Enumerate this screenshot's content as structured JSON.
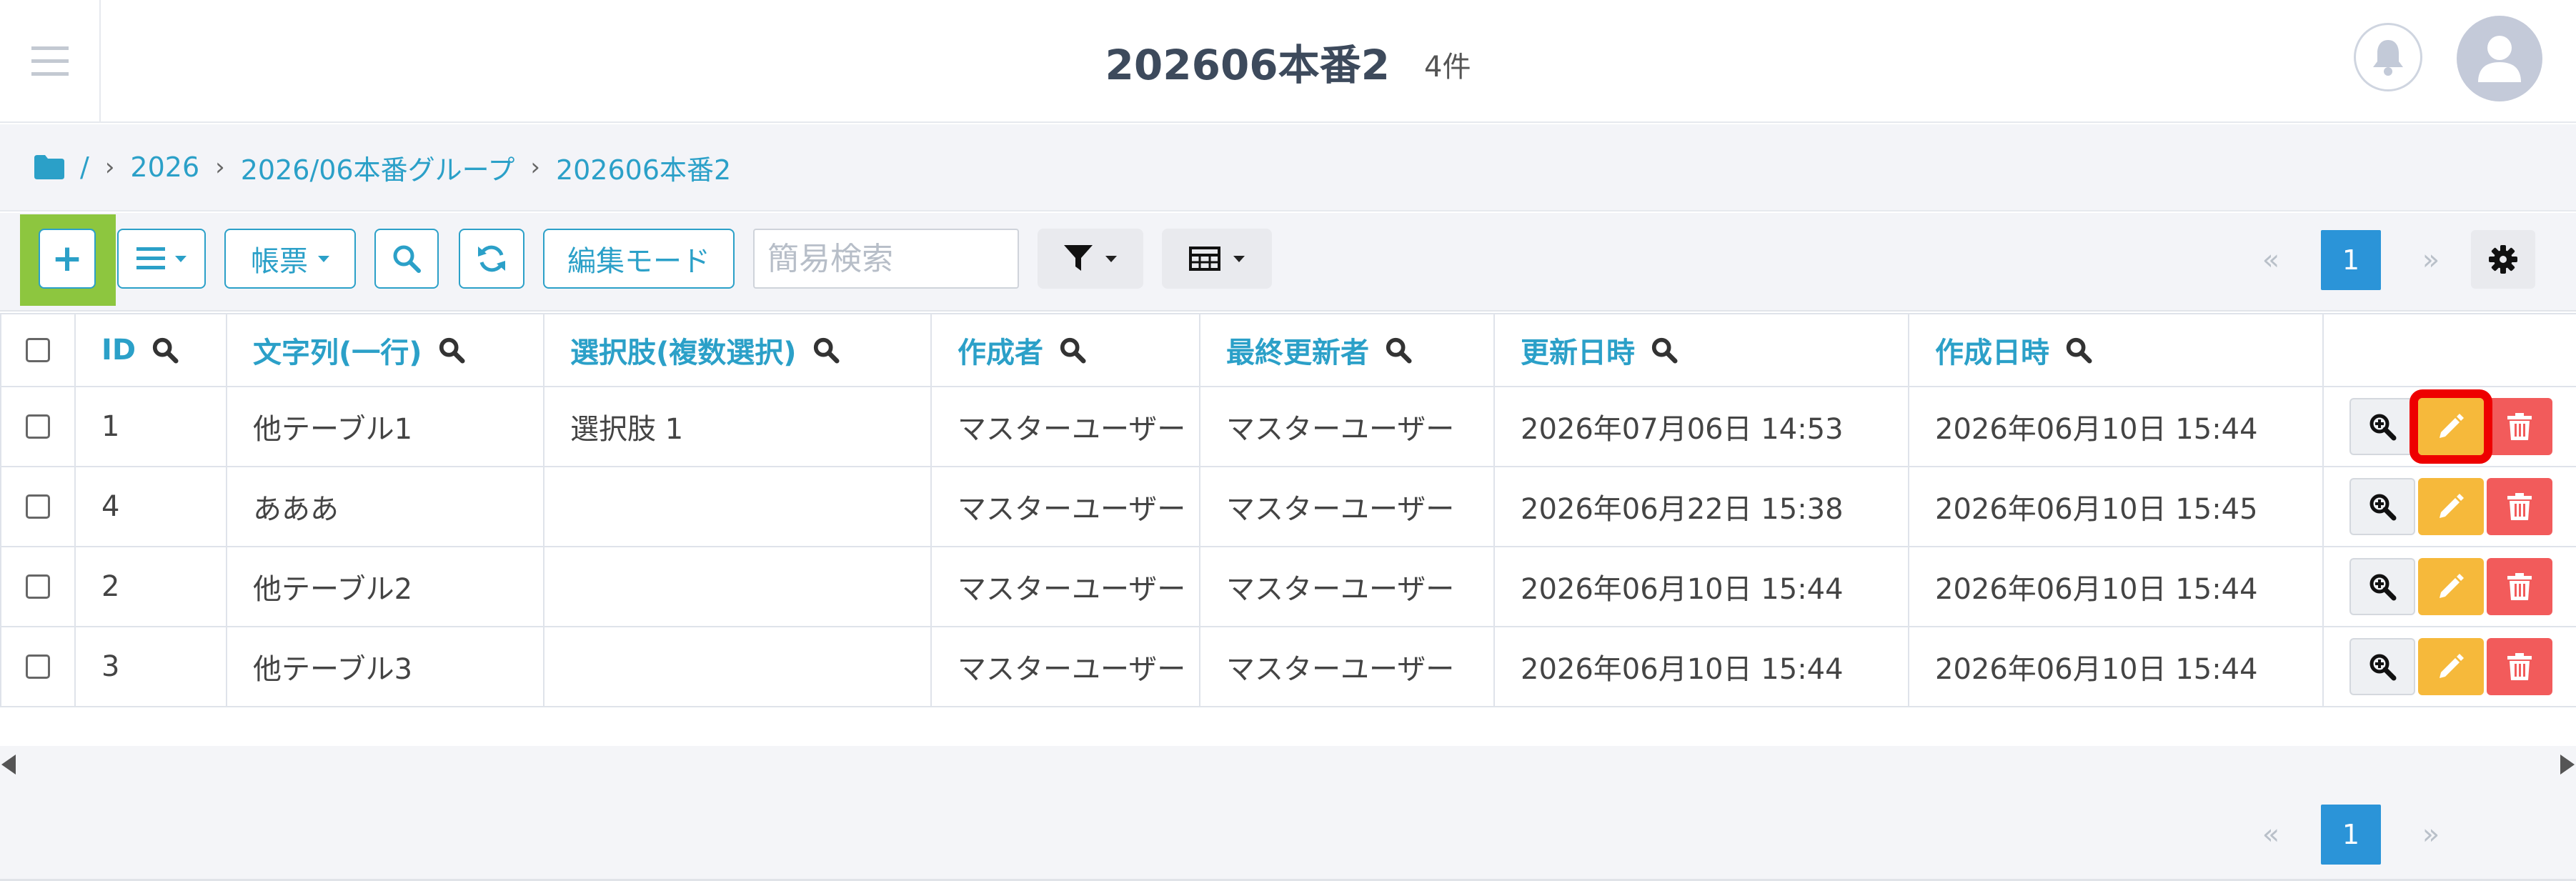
{
  "header": {
    "title": "202606本番2",
    "count": "4件"
  },
  "breadcrumb": {
    "root": "/",
    "items": [
      "2026",
      "2026/06本番グループ",
      "202606本番2"
    ]
  },
  "toolbar": {
    "add_label": "+",
    "report_label": "帳票",
    "edit_mode_label": "編集モード",
    "search_placeholder": "簡易検索",
    "pager": {
      "prev": "«",
      "current": "1",
      "next": "»"
    }
  },
  "table": {
    "columns": [
      "ID",
      "文字列(一行)",
      "選択肢(複数選択)",
      "作成者",
      "最終更新者",
      "更新日時",
      "作成日時"
    ],
    "rows": [
      {
        "id": "1",
        "text": "他テーブル1",
        "choice": "選択肢 1",
        "creator": "マスターユーザー",
        "updater": "マスターユーザー",
        "updated": "2026年07月06日 14:53",
        "created": "2026年06月10日 15:44"
      },
      {
        "id": "4",
        "text": "あああ",
        "choice": "",
        "creator": "マスターユーザー",
        "updater": "マスターユーザー",
        "updated": "2026年06月22日 15:38",
        "created": "2026年06月10日 15:45"
      },
      {
        "id": "2",
        "text": "他テーブル2",
        "choice": "",
        "creator": "マスターユーザー",
        "updater": "マスターユーザー",
        "updated": "2026年06月10日 15:44",
        "created": "2026年06月10日 15:44"
      },
      {
        "id": "3",
        "text": "他テーブル3",
        "choice": "",
        "creator": "マスターユーザー",
        "updater": "マスターユーザー",
        "updated": "2026年06月10日 15:44",
        "created": "2026年06月10日 15:44"
      }
    ]
  },
  "bottom_pager": {
    "prev": "«",
    "current": "1",
    "next": "»"
  },
  "colors": {
    "accent": "#2ba0c8",
    "edit": "#f6b93b",
    "delete": "#f25b5b",
    "page_active": "#2b94d8",
    "add_highlight": "#8dc63f",
    "edit_highlight": "#ee0000"
  },
  "icons": [
    "hamburger-icon",
    "bell-icon",
    "user-icon",
    "folder-icon",
    "plus-icon",
    "list-icon",
    "search-icon",
    "refresh-icon",
    "filter-icon",
    "table-icon",
    "gear-icon",
    "zoom-icon",
    "pencil-icon",
    "trash-icon"
  ]
}
